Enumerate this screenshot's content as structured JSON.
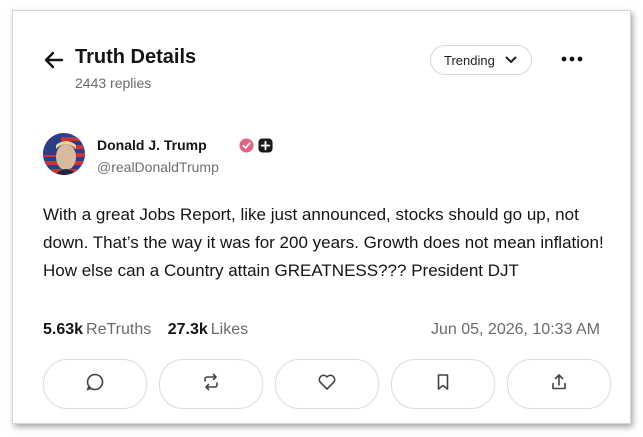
{
  "header": {
    "title": "Truth Details",
    "replies": "2443 replies",
    "sort_label": "Trending"
  },
  "post": {
    "author_name": "Donald J. Trump",
    "author_handle": "@realDonaldTrump",
    "text": "With a great Jobs Report, like just announced, stocks should go up, not down. That’s the way it was for 200 years. Growth does not mean inflation! How else can a Country attain GREATNESS??? President DJT",
    "retruths_count": "5.63k",
    "retruths_label": "ReTruths",
    "likes_count": "27.3k",
    "likes_label": "Likes",
    "timestamp": "Jun 05, 2026, 10:33 AM"
  },
  "icons": {
    "back": "arrow-left-icon",
    "sort": "chevron-down-icon",
    "more": "more-horizontal-icon",
    "verified": "verified-badge-icon",
    "plus": "plus-badge-icon",
    "actions": [
      "reply-icon",
      "retruth-icon",
      "like-icon",
      "bookmark-icon",
      "share-icon"
    ]
  },
  "colors": {
    "verified_badge": "#e0637f",
    "text_primary": "#141414",
    "text_secondary": "#6b6b6b",
    "border": "#dcdcdc"
  }
}
